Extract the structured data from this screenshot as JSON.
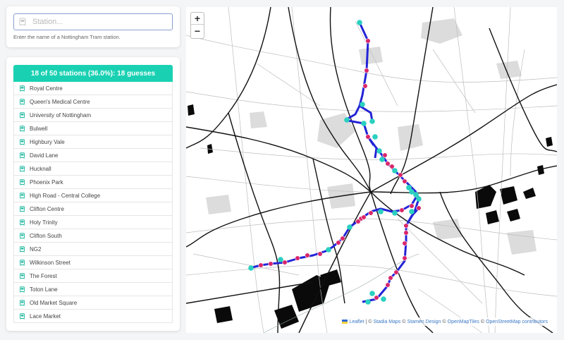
{
  "search": {
    "placeholder": "Station...",
    "help": "Enter the name of a Nottingham Tram station."
  },
  "summary": "18 of 50 stations (36.0%): 18 guesses",
  "progress": {
    "found": 18,
    "total": 50,
    "guesses": 18
  },
  "stations": [
    "Royal Centre",
    "Queen's Medical Centre",
    "University of Nottingham",
    "Bulwell",
    "Highbury Vale",
    "David Lane",
    "Hucknall",
    "Phoenix Park",
    "High Road - Central College",
    "Clifton Centre",
    "Holy Trinity",
    "Clifton South",
    "NG2",
    "Wilkinson Street",
    "The Forest",
    "Toton Lane",
    "Old Market Square",
    "Lace Market"
  ],
  "map": {
    "zoom_in": "+",
    "zoom_out": "−",
    "attribution": {
      "leaflet": "Leaflet",
      "sep1": "|",
      "c1": "©",
      "stadia": "Stadia Maps",
      "c2": "©",
      "stamen": "Stamen Design",
      "c3": "©",
      "omt": "OpenMapTiles",
      "c4": "©",
      "osm": "OpenStreetMap contributors"
    }
  },
  "colors": {
    "accent": "#19d1b2",
    "line": "#2323d6",
    "found_station": "#2ad0c0",
    "unfound_station": "#d9266b"
  },
  "icons": {
    "station": "tram-icon",
    "zoom_in": "plus-icon",
    "zoom_out": "minus-icon"
  }
}
